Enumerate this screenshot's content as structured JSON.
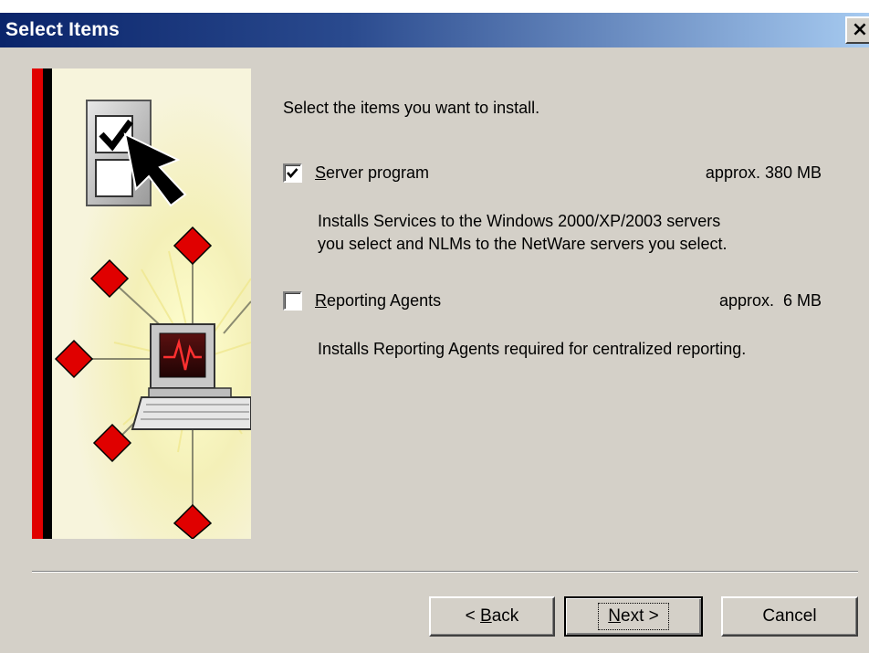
{
  "window": {
    "title": "Select Items",
    "close_glyph": "×"
  },
  "main": {
    "prompt": "Select the items you want to install.",
    "items": [
      {
        "label": "Server program",
        "accelerator": "S",
        "label_rest": "erver program",
        "checked": true,
        "size": "approx. 380 MB",
        "description": [
          "Installs Services to the Windows 2000/XP/2003 servers",
          "you select and NLMs to the NetWare servers you select."
        ]
      },
      {
        "label": "Reporting Agents",
        "accelerator": "R",
        "label_rest": "eporting Agents",
        "checked": false,
        "size": "approx.  6 MB",
        "description": [
          "Installs Reporting Agents required for centralized reporting."
        ]
      }
    ]
  },
  "buttons": {
    "back": {
      "pre": "< ",
      "accel": "B",
      "rest": "ack"
    },
    "next": {
      "accel": "N",
      "rest": "ext >"
    },
    "cancel": {
      "label": "Cancel"
    }
  },
  "colors": {
    "title_gradient_start": "#0a246a",
    "title_gradient_end": "#a6caf0",
    "dialog_face": "#d4d0c8",
    "accent_red": "#e00000"
  },
  "icons": [
    "close-icon",
    "checkbox-checked-icon",
    "checkbox-unchecked-icon",
    "installer-illustration"
  ]
}
